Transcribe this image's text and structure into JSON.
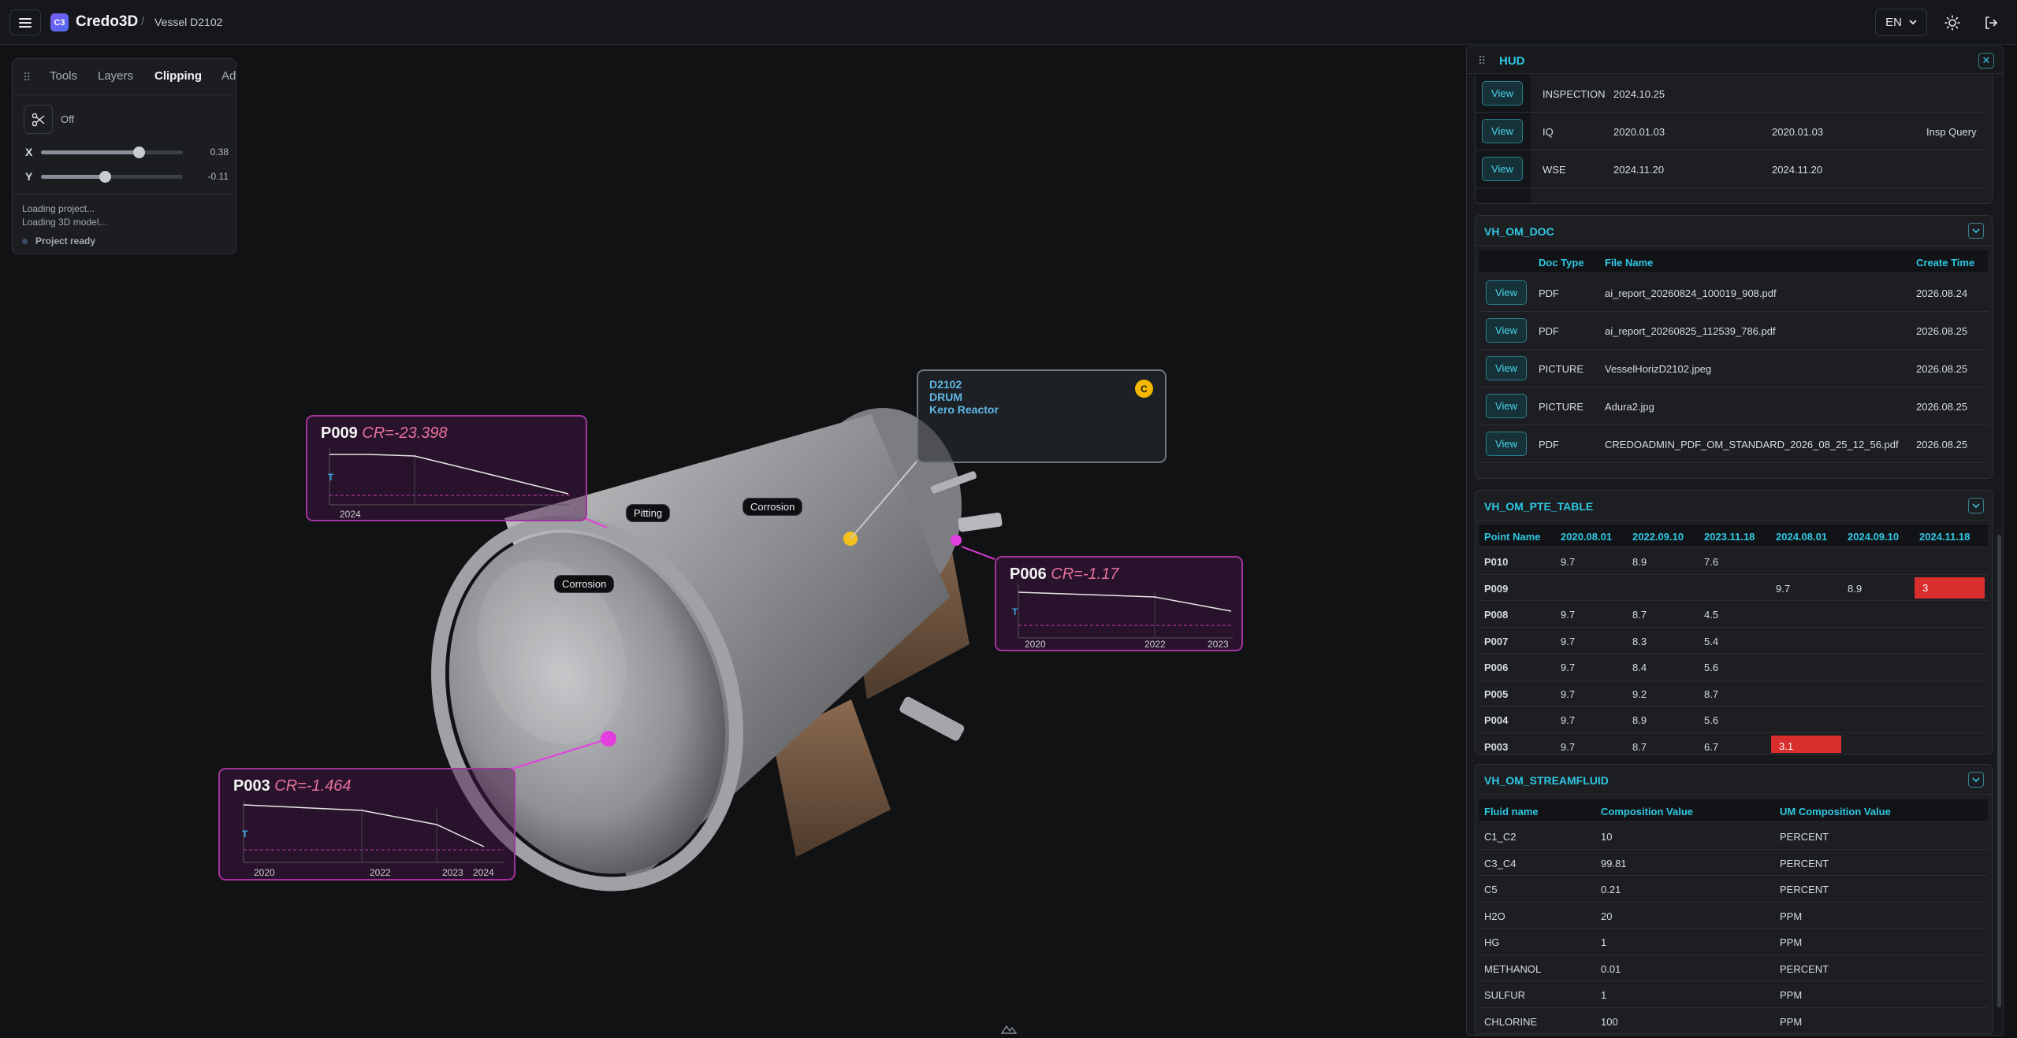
{
  "header": {
    "app_title": "Credo3D",
    "logo_text": "C3",
    "separator": "/",
    "breadcrumb": "Vessel D2102",
    "language": "EN"
  },
  "tool_panel": {
    "tabs": [
      "Tools",
      "Layers",
      "Clipping",
      "Ad"
    ],
    "active_tab": "Clipping",
    "clipping_state": "Off",
    "sliders": [
      {
        "axis": "X",
        "value": "0.38",
        "fraction": 0.69
      },
      {
        "axis": "Y",
        "value": "-0.11",
        "fraction": 0.45
      }
    ],
    "log": [
      "Loading project...",
      "Loading 3D model..."
    ],
    "status": "Project ready"
  },
  "viewport": {
    "labels": [
      "Pitting",
      "Corrosion",
      "Corrosion"
    ],
    "info_box": {
      "line1": "D2102",
      "line2": "DRUM",
      "line3": "Kero Reactor",
      "badge": "C"
    },
    "point_cards": [
      {
        "point": "P009",
        "cr": "CR=-23.398",
        "t_label": "T",
        "years": [
          "2024"
        ]
      },
      {
        "point": "P006",
        "cr": "CR=-1.17",
        "t_label": "T",
        "years": [
          "2020",
          "2022",
          "2023"
        ]
      },
      {
        "point": "P003",
        "cr": "CR=-1.464",
        "t_label": "T",
        "years": [
          "2020",
          "2022",
          "2023",
          "2024"
        ]
      }
    ]
  },
  "hud": {
    "title": "HUD",
    "view_label": "View",
    "inspections": [
      {
        "type": "INSPECTION",
        "date1": "2024.10.25",
        "date2": "",
        "note": ""
      },
      {
        "type": "IQ",
        "date1": "2020.01.03",
        "date2": "2020.01.03",
        "note": "Insp Query"
      },
      {
        "type": "WSE",
        "date1": "2024.11.20",
        "date2": "2024.11.20",
        "note": ""
      }
    ],
    "doc": {
      "title": "VH_OM_DOC",
      "columns": [
        "Doc Type",
        "File Name",
        "Create Time"
      ],
      "rows": [
        [
          "PDF",
          "ai_report_20260824_100019_908.pdf",
          "2026.08.24"
        ],
        [
          "PDF",
          "ai_report_20260825_112539_786.pdf",
          "2026.08.25"
        ],
        [
          "PICTURE",
          "VesselHorizD2102.jpeg",
          "2026.08.25"
        ],
        [
          "PICTURE",
          "Adura2.jpg",
          "2026.08.25"
        ],
        [
          "PDF",
          "CREDOADMIN_PDF_OM_STANDARD_2026_08_25_12_56.pdf",
          "2026.08.25"
        ]
      ]
    },
    "pte": {
      "title": "VH_OM_PTE_TABLE",
      "columns": [
        "Point Name",
        "2020.08.01",
        "2022.09.10",
        "2023.11.18",
        "2024.08.01",
        "2024.09.10",
        "2024.11.18"
      ],
      "rows": [
        [
          "P010",
          "9.7",
          "8.9",
          "7.6",
          "",
          "",
          ""
        ],
        [
          "P009",
          "",
          "",
          "",
          "9.7",
          "8.9",
          "3"
        ],
        [
          "P008",
          "9.7",
          "8.7",
          "4.5",
          "",
          "",
          ""
        ],
        [
          "P007",
          "9.7",
          "8.3",
          "5.4",
          "",
          "",
          ""
        ],
        [
          "P006",
          "9.7",
          "8.4",
          "5.6",
          "",
          "",
          ""
        ],
        [
          "P005",
          "9.7",
          "9.2",
          "8.7",
          "",
          "",
          ""
        ],
        [
          "P004",
          "9.7",
          "8.9",
          "5.6",
          "",
          "",
          ""
        ],
        [
          "P003",
          "9.7",
          "8.7",
          "6.7",
          "3.1",
          "",
          ""
        ]
      ],
      "alert_color": "#d82e2e"
    },
    "stream": {
      "title": "VH_OM_STREAMFLUID",
      "columns": [
        "Fluid name",
        "Composition Value",
        "UM Composition Value"
      ],
      "rows": [
        [
          "C1_C2",
          "10",
          "PERCENT"
        ],
        [
          "C3_C4",
          "99.81",
          "PERCENT"
        ],
        [
          "C5",
          "0.21",
          "PERCENT"
        ],
        [
          "H2O",
          "20",
          "PPM"
        ],
        [
          "HG",
          "1",
          "PPM"
        ],
        [
          "METHANOL",
          "0.01",
          "PERCENT"
        ],
        [
          "SULFUR",
          "1",
          "PPM"
        ],
        [
          "CHLORINE",
          "100",
          "PPM"
        ]
      ]
    }
  }
}
